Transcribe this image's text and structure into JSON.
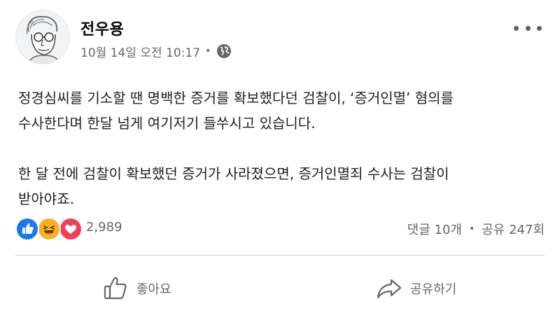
{
  "post": {
    "author": "전우용",
    "timestamp": "10월 14일 오전 10:17",
    "separator": "•",
    "visibility_icon": "globe-icon",
    "more_icon": "more-options-icon",
    "paragraphs": [
      [
        "정경심씨를 기소할 땐 명백한 증거를 확보했다던 검찰이, ‘증거인멸’ 혐의를",
        "수사한다며 한달 넘게 여기저기 들쑤시고 있습니다."
      ],
      [
        "한 달 전에 검찰이 확보했던 증거가 사라졌으면, 증거인멸죄 수사는 검찰이",
        "받아야죠."
      ]
    ]
  },
  "engagement": {
    "reaction_types": [
      "like",
      "haha",
      "love"
    ],
    "reaction_count": "2,989",
    "comments": "댓글 10개",
    "bullet": "•",
    "shares": "공유 247회"
  },
  "actions": {
    "like_label": "좋아요",
    "share_label": "공유하기"
  },
  "colors": {
    "like_blue": "#1877f2",
    "haha_yellow": "#f7b125",
    "love_red": "#f33e58",
    "secondary_text": "#65676b"
  }
}
